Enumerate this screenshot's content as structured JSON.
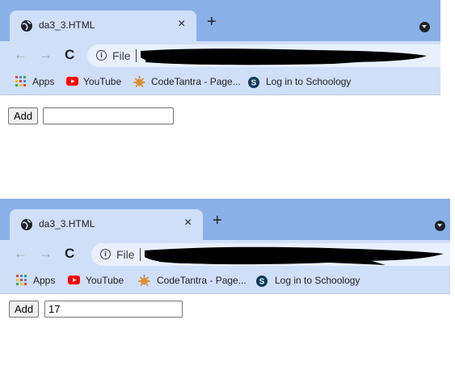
{
  "browser": {
    "tab_title": "da3_3.HTML",
    "tab_close": "×",
    "new_tab": "+",
    "address_scheme": "File",
    "address_separator": "|",
    "nav_back": "←",
    "nav_forward": "→",
    "nav_reload": "C",
    "info_symbol": "i",
    "bookmarks": [
      "Apps",
      "YouTube",
      "CodeTantra - Page...",
      "Log in to Schoology"
    ]
  },
  "screens": [
    {
      "add_label": "Add",
      "input_value": ""
    },
    {
      "add_label": "Add",
      "input_value": "17"
    }
  ],
  "colors": {
    "tabstrip": "#8ab0e8",
    "toolbar": "#cfdff7",
    "youtube_red": "#ff0000",
    "codetantra_orange": "#e0902a"
  }
}
